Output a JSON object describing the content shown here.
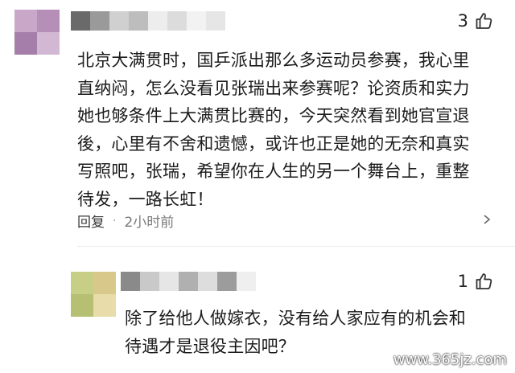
{
  "comments": [
    {
      "likes": "3",
      "lines": [
        "北京大满贯时，国乒派出那么多运动员参赛，我心里",
        "直纳闷，怎么没看见张瑞出来参赛呢？论资质和实力",
        "她也够条件上大满贯比赛的，今天突然看到她官宣退",
        "後，心里有不舍和遗憾，或许也正是她的无奈和真实",
        "写照吧，张瑞，希望你在人生的另一个舞台上，重整",
        "待发，一路长虹！"
      ],
      "reply_label": "回复",
      "separator": "·",
      "time": "2小时前"
    },
    {
      "likes": "1",
      "lines": [
        "除了给他人做嫁衣，没有给人家应有的机会和",
        "待遇才是退役主因吧？"
      ]
    }
  ],
  "watermark": "www.365jz.com",
  "icons": {
    "like": "thumbs-up-icon",
    "more": "chevron-right-icon"
  }
}
